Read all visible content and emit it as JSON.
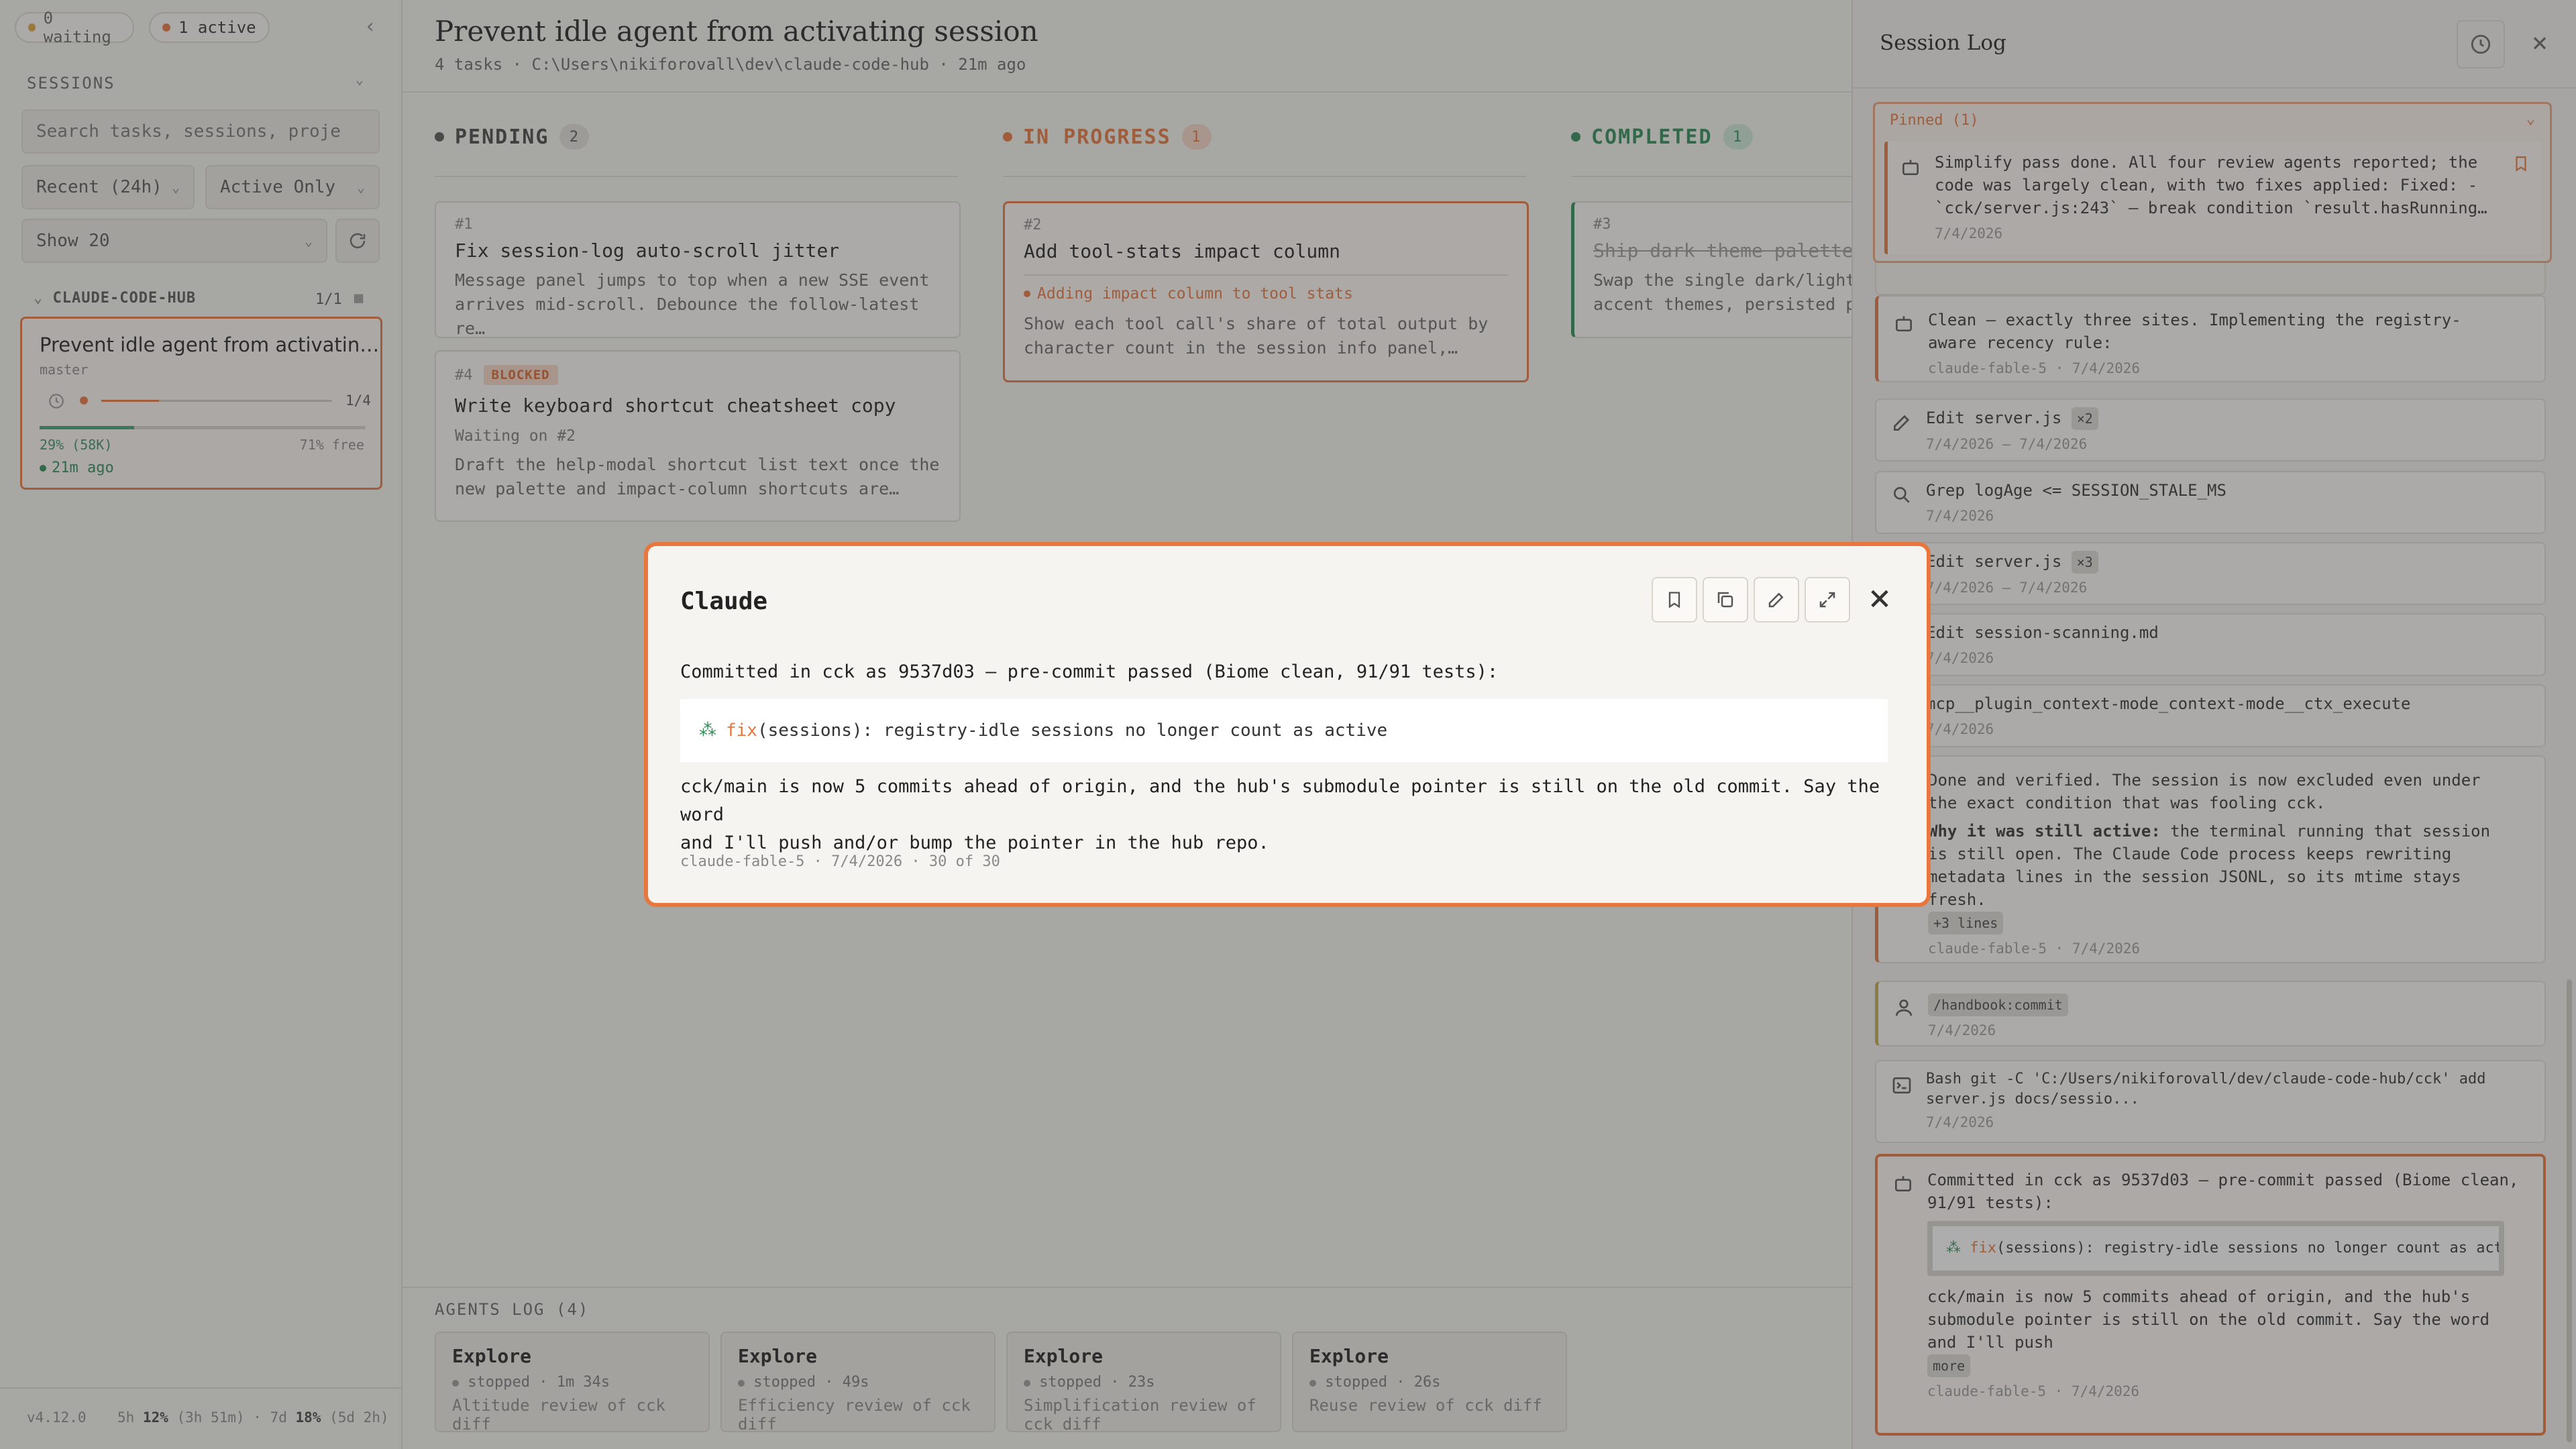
{
  "sidebar": {
    "waiting_label": "0 waiting",
    "active_label": "1 active",
    "sessions_heading": "SESSIONS",
    "search_placeholder": "Search tasks, sessions, proje",
    "filter_recent": "Recent (24h)",
    "filter_active": "Active Only",
    "show_count": "Show 20",
    "group_name": "CLAUDE-CODE-HUB",
    "group_count": "1/1",
    "session": {
      "title": "Prevent idle agent from activatin…",
      "branch": "master",
      "progress_label": "1/4",
      "context_used": "29% (58K)",
      "context_free": "71% free",
      "progress": 0.25,
      "context_fraction": 0.29,
      "time": "21m ago"
    },
    "version": "v4.12.0",
    "usage_5h_prefix": "5h ",
    "usage_5h_pct": "12%",
    "usage_5h_reset": " (3h 51m) · 7d ",
    "usage_7d_pct": "18%",
    "usage_7d_reset": " (5d 2h)"
  },
  "main": {
    "title": "Prevent idle agent from activating session",
    "subtitle": "4 tasks · C:\\Users\\nikiforovall\\dev\\claude-code-hub · 21m ago",
    "columns": [
      {
        "label": "PENDING",
        "count": "2"
      },
      {
        "label": "IN PROGRESS",
        "count": "1"
      },
      {
        "label": "COMPLETED",
        "count": "1"
      }
    ],
    "tasks": {
      "t1": {
        "num": "#1",
        "title": "Fix session-log auto-scroll jitter",
        "desc1": "Message panel jumps to top when a new SSE event",
        "desc2": "arrives mid-scroll. Debounce the follow-latest re…"
      },
      "t4": {
        "num": "#4",
        "badge": "BLOCKED",
        "title": "Write keyboard shortcut cheatsheet copy",
        "waiting": "Waiting on #2",
        "desc1": "Draft the help-modal shortcut list text once the",
        "desc2": "new palette and impact-column shortcuts are…"
      },
      "t2": {
        "num": "#2",
        "title": "Add tool-stats impact column",
        "status": "Adding impact column to tool stats",
        "desc1": "Show each tool call's share of total output by",
        "desc2": "character count in the session info panel,…"
      },
      "t3": {
        "num": "#3",
        "title": "Ship dark theme palette p",
        "desc1": "Swap the single dark/light",
        "desc2": "accent themes, persisted pe"
      }
    },
    "agents_heading": "AGENTS LOG (4)",
    "agents": [
      {
        "name": "Explore",
        "status": "stopped · 1m 34s",
        "desc": "Altitude review of cck diff"
      },
      {
        "name": "Explore",
        "status": "stopped · 49s",
        "desc": "Efficiency review of cck diff"
      },
      {
        "name": "Explore",
        "status": "stopped · 23s",
        "desc": "Simplification review of cck diff"
      },
      {
        "name": "Explore",
        "status": "stopped · 26s",
        "desc": "Reuse review of cck diff"
      }
    ]
  },
  "log": {
    "title": "Session Log",
    "pinned_label": "Pinned (1)",
    "pinned_text1": "Simplify pass done. All four review agents reported; the",
    "pinned_text2": "code was largely clean, with two fixes applied: Fixed: -",
    "pinned_text3": "`cck/server.js:243` — break condition `result.hasRunning…",
    "pinned_meta": "7/4/2026",
    "items": {
      "a": {
        "t1": "Clean — exactly three sites. Implementing the registry-",
        "t2": "aware recency rule:",
        "meta": "claude-fable-5 · 7/4/2026"
      },
      "b": {
        "t": "Edit server.js",
        "badge": "×2",
        "meta": "7/4/2026 – 7/4/2026"
      },
      "c": {
        "t": "Grep logAge <= SESSION_STALE_MS",
        "meta": "7/4/2026"
      },
      "d": {
        "t": "Edit server.js",
        "badge": "×3",
        "meta": "7/4/2026 – 7/4/2026"
      },
      "e": {
        "t": "Edit session-scanning.md",
        "meta": "7/4/2026"
      },
      "f": {
        "t": "mcp__plugin_context-mode_context-mode__ctx_execute",
        "meta": "7/4/2026"
      },
      "g": {
        "t1": "Done and verified. The session is now excluded even under",
        "t2": "the exact condition that was fooling cck.",
        "bold": "Why it was still active:",
        "t3": " the terminal running that session",
        "t4": "is still open. The Claude Code process keeps rewriting",
        "t5": "metadata lines in the session JSONL, so its mtime stays",
        "t6": "fresh.",
        "more": "+3 lines",
        "meta": "claude-fable-5 · 7/4/2026"
      },
      "h": {
        "t": "/handbook:commit",
        "meta": "7/4/2026"
      },
      "i": {
        "t1": "Bash git -C 'C:/Users/nikiforovall/dev/claude-code-hub/cck' add",
        "t2": "server.js docs/sessio...",
        "meta": "7/4/2026"
      },
      "j": {
        "t1": "Committed in cck as 9537d03 — pre-commit passed (Biome clean,",
        "t2": "91/91 tests):",
        "code_kw": "fix",
        "code_rest": "(sessions): registry-idle sessions no longer count as active",
        "t3": "cck/main is now 5 commits ahead of origin, and the hub's",
        "t4": "submodule pointer is still on the old commit. Say the word",
        "t5": "and I'll push",
        "more": "more",
        "meta": "claude-fable-5 · 7/4/2026"
      }
    }
  },
  "modal": {
    "title": "Claude",
    "intro": "Committed in cck as 9537d03 — pre-commit passed (Biome clean, 91/91 tests):",
    "code_kw": "fix",
    "code_rest": "(sessions): registry-idle sessions no longer count as active",
    "body1": "cck/main is now 5 commits ahead of origin, and the hub's submodule pointer is still on the old commit. Say the word",
    "body2": "and I'll push and/or bump the pointer in the hub repo.",
    "meta": "claude-fable-5 · 7/4/2026 · 30 of 30"
  },
  "colors": {
    "accent": "#e8763d",
    "green": "#2e8b57",
    "pending": "#555555"
  }
}
